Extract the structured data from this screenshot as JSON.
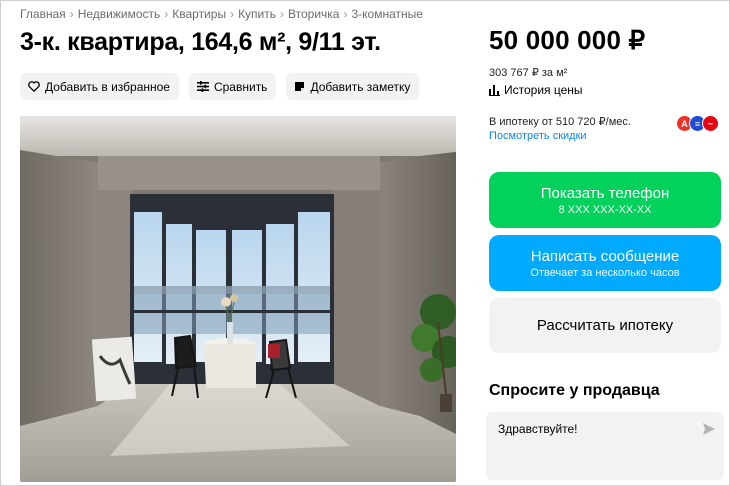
{
  "breadcrumb": {
    "items": [
      "Главная",
      "Недвижимость",
      "Квартиры",
      "Купить",
      "Вторичка",
      "3-комнатные"
    ]
  },
  "listing": {
    "title": "3-к. квартира, 164,6 м², 9/11 эт."
  },
  "actions": {
    "favorite": "Добавить в избранное",
    "compare": "Сравнить",
    "note": "Добавить заметку"
  },
  "price": {
    "amount": "50 000 000 ₽",
    "per_meter": "303 767 ₽ за м²",
    "history": "История цены"
  },
  "mortgage": {
    "text": "В ипотеку от 510 720 ₽/мес.",
    "discounts_link": "Посмотреть скидки",
    "banks": [
      {
        "letter": "А",
        "color": "#ef3124"
      },
      {
        "letter": "≡",
        "color": "#1e4bd2"
      },
      {
        "letter": "~",
        "color": "#e30611"
      }
    ]
  },
  "contact": {
    "phone_label": "Показать телефон",
    "phone_masked": "8 XXX XXX-XX-XX",
    "message_label": "Написать сообщение",
    "message_sub": "Отвечает за несколько часов",
    "calc_label": "Рассчитать ипотеку"
  },
  "seller": {
    "heading": "Спросите у продавца",
    "message_value": "Здравствуйте!"
  },
  "colors": {
    "green": "#02d15c",
    "blue": "#00aaff",
    "link": "#0a88e8"
  }
}
